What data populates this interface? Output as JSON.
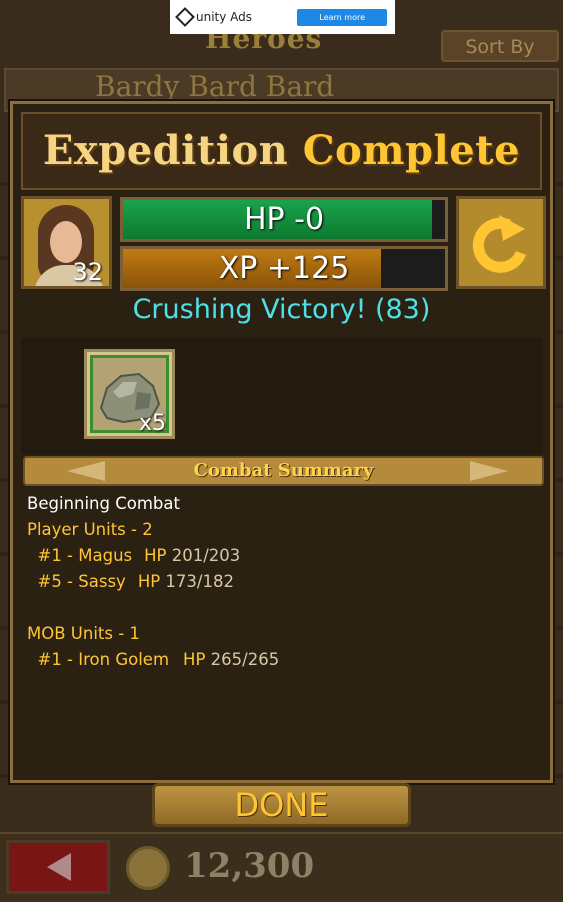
{
  "ad": {
    "brand": "unity Ads",
    "cta": "Learn more"
  },
  "background": {
    "screen_title": "Heroes",
    "sort_label": "Sort By",
    "hero_row_name": "Bardy Bard Bard",
    "coins": "12,300"
  },
  "modal": {
    "title_part1": "Expedition",
    "title_part2": "Complete",
    "hero": {
      "level": "32"
    },
    "hp_text": "HP -0",
    "hp_fill_fraction": 0.96,
    "xp_text": "XP +125",
    "xp_fill_fraction": 0.8,
    "result": "Crushing Victory! (83)",
    "loot": [
      {
        "icon": "stone-ore-icon",
        "qty": "x5"
      }
    ],
    "summary_title": "Combat Summary",
    "log": {
      "line1": "Beginning Combat",
      "player_header": "Player Units - 2",
      "player1_name": "  #1 - Magus",
      "player1_hp_label": "HP",
      "player1_hp": "201/203",
      "player2_name": "  #5 - Sassy",
      "player2_hp_label": "HP",
      "player2_hp": "173/182",
      "mob_header": "MOB Units - 1",
      "mob1_name": "  #1 - Iron Golem",
      "mob1_hp_label": "HP",
      "mob1_hp": "265/265"
    },
    "done_label": "DONE"
  },
  "colors": {
    "title_gold": "#ffc533",
    "result_cyan": "#4ee0e6",
    "hp_green": "#1aa34a",
    "xp_orange": "#c07b14"
  }
}
